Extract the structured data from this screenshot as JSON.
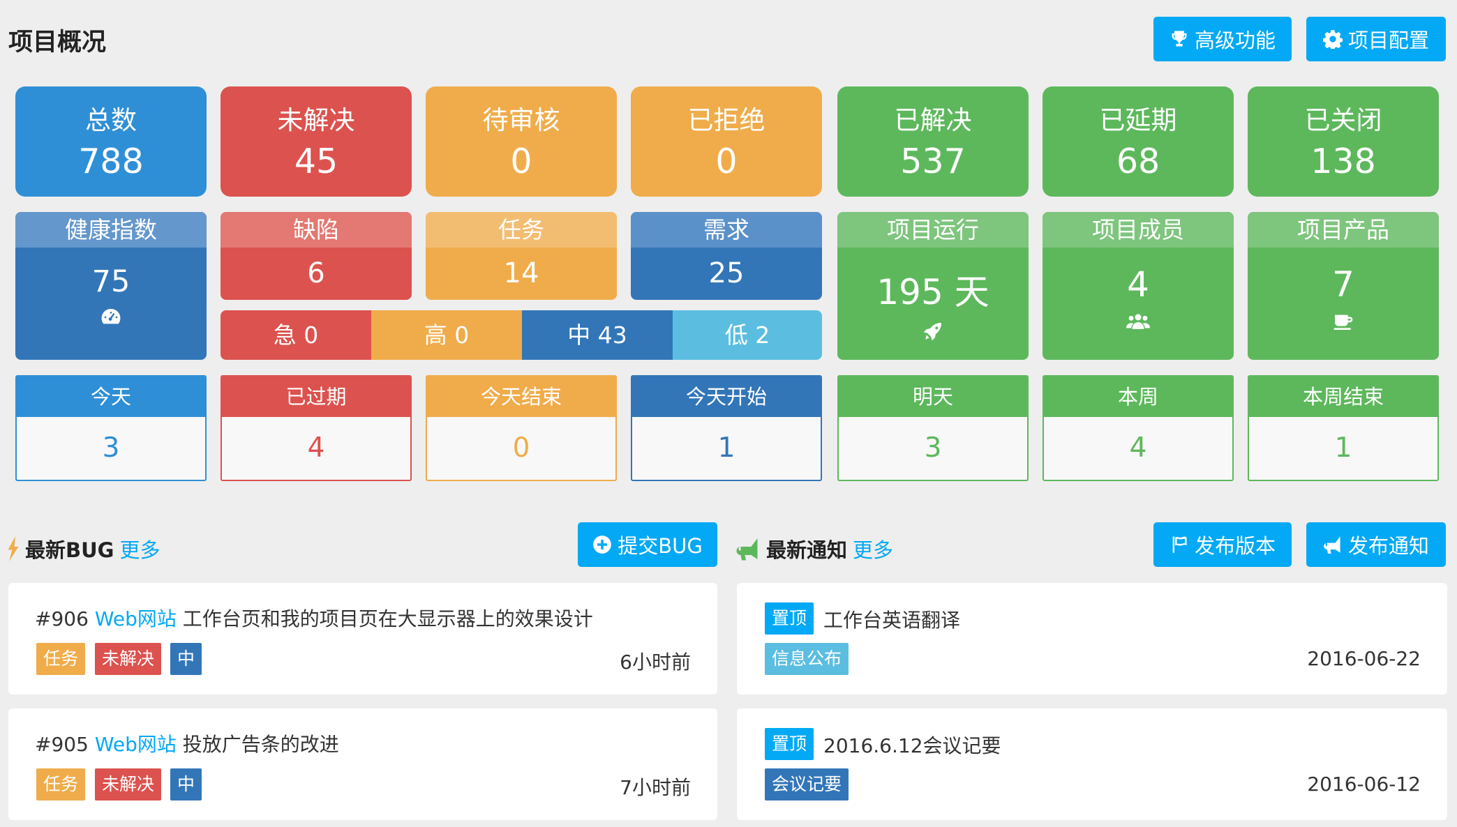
{
  "header": {
    "title": "项目概况",
    "advanced_label": "高级功能",
    "config_label": "项目配置"
  },
  "stats": [
    {
      "label": "总数",
      "value": "788",
      "color": "#2f8fd6"
    },
    {
      "label": "未解决",
      "value": "45",
      "color": "#dc524e"
    },
    {
      "label": "待审核",
      "value": "0",
      "color": "#f0ac4a"
    },
    {
      "label": "已拒绝",
      "value": "0",
      "color": "#f0ac4a"
    },
    {
      "label": "已解决",
      "value": "537",
      "color": "#5db85c"
    },
    {
      "label": "已延期",
      "value": "68",
      "color": "#5db85c"
    },
    {
      "label": "已关闭",
      "value": "138",
      "color": "#5db85c"
    }
  ],
  "health": {
    "label": "健康指数",
    "value": "75",
    "icon": "dashboard-icon"
  },
  "types": [
    {
      "label": "缺陷",
      "value": "6"
    },
    {
      "label": "任务",
      "value": "14"
    },
    {
      "label": "需求",
      "value": "25"
    }
  ],
  "priorities": [
    {
      "label": "急 0"
    },
    {
      "label": "高 0"
    },
    {
      "label": "中 43"
    },
    {
      "label": "低 2"
    }
  ],
  "project": [
    {
      "label": "项目运行",
      "value": "195 天",
      "icon": "rocket-icon"
    },
    {
      "label": "项目成员",
      "value": "4",
      "icon": "users-icon"
    },
    {
      "label": "项目产品",
      "value": "7",
      "icon": "coffee-icon"
    }
  ],
  "dates": [
    {
      "label": "今天",
      "value": "3",
      "color": "#2f8fd6"
    },
    {
      "label": "已过期",
      "value": "4",
      "color": "#dc524e"
    },
    {
      "label": "今天结束",
      "value": "0",
      "color": "#f0ac4a"
    },
    {
      "label": "今天开始",
      "value": "1",
      "color": "#3276b8"
    },
    {
      "label": "明天",
      "value": "3",
      "color": "#5db85c"
    },
    {
      "label": "本周",
      "value": "4",
      "color": "#5db85c"
    },
    {
      "label": "本周结束",
      "value": "1",
      "color": "#5db85c"
    }
  ],
  "bugs": {
    "title": "最新BUG",
    "more": "更多",
    "submit_label": "提交BUG",
    "items": [
      {
        "id": "#906",
        "project": "Web网站",
        "text": "工作台页和我的项目页在大显示器上的效果设计",
        "type": "任务",
        "status": "未解决",
        "priority": "中",
        "time": "6小时前"
      },
      {
        "id": "#905",
        "project": "Web网站",
        "text": "投放广告条的改进",
        "type": "任务",
        "status": "未解决",
        "priority": "中",
        "time": "7小时前"
      }
    ]
  },
  "notices": {
    "title": "最新通知",
    "more": "更多",
    "release_label": "发布版本",
    "publish_label": "发布通知",
    "items": [
      {
        "pin": "置顶",
        "text": "工作台英语翻译",
        "category": "信息公布",
        "date": "2016-06-22"
      },
      {
        "pin": "置顶",
        "text": "2016.6.12会议记要",
        "category": "会议记要",
        "date": "2016-06-12"
      }
    ]
  }
}
